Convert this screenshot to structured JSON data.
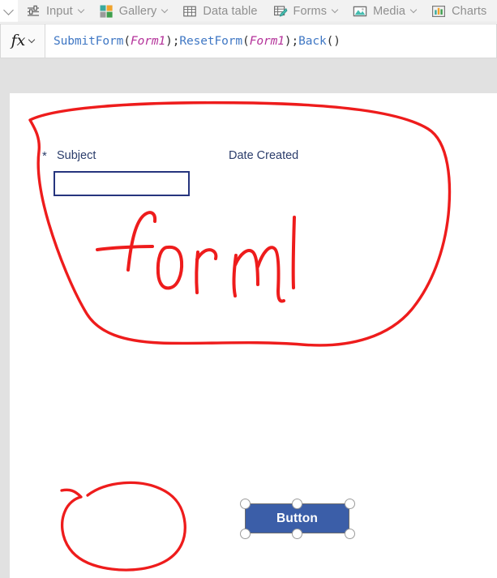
{
  "ribbon": {
    "overflow_icon": "chevron-left-icon",
    "items": [
      {
        "label": "Input",
        "icon": "sliders-icon",
        "has_dropdown": true
      },
      {
        "label": "Gallery",
        "icon": "gallery-grid-icon",
        "has_dropdown": true
      },
      {
        "label": "Data table",
        "icon": "table-grid-icon",
        "has_dropdown": false
      },
      {
        "label": "Forms",
        "icon": "forms-pencil-icon",
        "has_dropdown": true
      },
      {
        "label": "Media",
        "icon": "image-icon",
        "has_dropdown": true
      },
      {
        "label": "Charts",
        "icon": "bar-chart-icon",
        "has_dropdown": false
      }
    ]
  },
  "formula_bar": {
    "fx_label": "fx",
    "fx_dropdown_icon": "chevron-down-icon",
    "value": "SubmitForm(Form1);ResetForm(Form1);Back()",
    "tokens": [
      {
        "text": "SubmitForm",
        "type": "fn"
      },
      {
        "text": "(",
        "type": "pun"
      },
      {
        "text": "Form1",
        "type": "ref"
      },
      {
        "text": ");",
        "type": "pun"
      },
      {
        "text": "ResetForm",
        "type": "fn"
      },
      {
        "text": "(",
        "type": "pun"
      },
      {
        "text": "Form1",
        "type": "ref"
      },
      {
        "text": ");",
        "type": "pun"
      },
      {
        "text": "Back",
        "type": "fn"
      },
      {
        "text": "()",
        "type": "pun"
      }
    ],
    "colors": {
      "function": "#3f77c4",
      "reference": "#b4329a",
      "punctuation": "#303030"
    }
  },
  "canvas": {
    "background": "#ffffff",
    "form": {
      "required_marker": "*",
      "fields": [
        {
          "label": "Subject",
          "value": "",
          "required": true
        },
        {
          "label": "Date Created",
          "value": "",
          "required": false
        }
      ]
    },
    "button": {
      "label": "Button",
      "selected": true,
      "fill_color": "#3b5ea8",
      "text_color": "#ffffff",
      "handle_count": 6
    },
    "annotations": [
      {
        "type": "ink-oval",
        "name": "form-circle",
        "color": "#ee1c1c",
        "target": "form1"
      },
      {
        "type": "ink-text",
        "name": "handwritten-form1",
        "color": "#ee1c1c",
        "text": "form1"
      },
      {
        "type": "ink-oval",
        "name": "button-circle",
        "color": "#ee1c1c",
        "target": "button"
      }
    ]
  },
  "chrome": {
    "gap_color": "#e1e1e1",
    "ribbon_bg": "#f2f2f2"
  }
}
